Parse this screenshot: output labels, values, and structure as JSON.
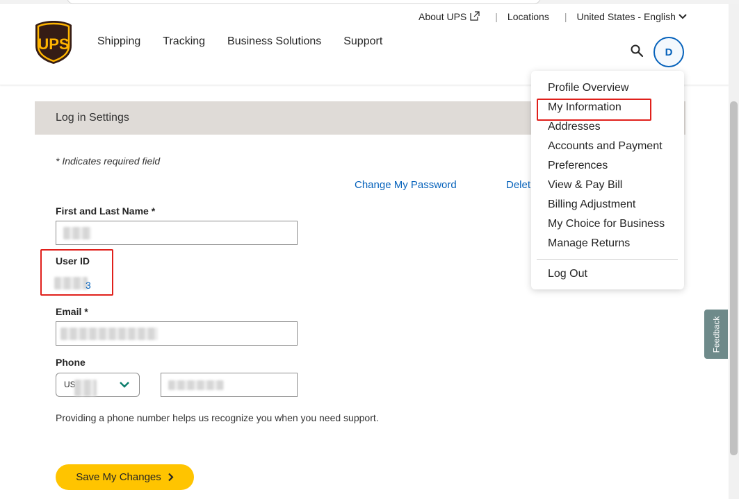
{
  "brand": {
    "logo_text": "UPS",
    "shield_color": "#351c15",
    "gold_color": "#ffb500"
  },
  "utility_nav": {
    "about": "About UPS",
    "locations": "Locations",
    "locale": "United States - English"
  },
  "main_nav": [
    "Shipping",
    "Tracking",
    "Business Solutions",
    "Support"
  ],
  "user": {
    "avatar_initial": "D"
  },
  "section": {
    "title": "Log in Settings"
  },
  "form": {
    "required_note": "* Indicates required field",
    "change_password": "Change My Password",
    "delete_link_partial": "Delet",
    "name_label": "First and Last Name *",
    "userid_label": "User ID",
    "userid_value_visible": "3",
    "email_label": "Email *",
    "phone_label": "Phone",
    "country_code_partial": "US",
    "help_text": "Providing a phone number helps us recognize you when you need support.",
    "save_button": "Save My Changes"
  },
  "profile_menu": {
    "items": [
      "Profile Overview",
      "My Information",
      "Addresses",
      "Accounts and Payment",
      "Preferences",
      "View & Pay Bill",
      "Billing Adjustment",
      "My Choice for Business",
      "Manage Returns"
    ],
    "logout": "Log Out"
  },
  "feedback_tab": "Feedback",
  "colors": {
    "link": "#0662bb",
    "primary_button": "#ffc400",
    "highlight": "#e0201b",
    "section_bar": "#dfdbd7"
  }
}
